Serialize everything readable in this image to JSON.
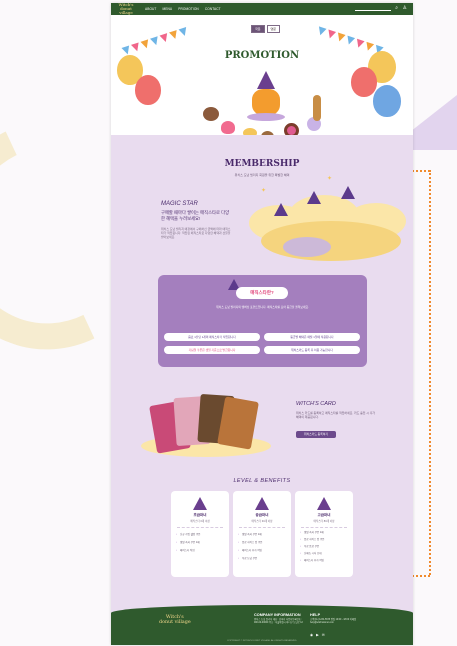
{
  "topbar": {
    "logo_line1": "Witch's",
    "logo_line2": "donut village",
    "nav": [
      "ABOUT",
      "MENU",
      "PROMOTION",
      "CONTACT"
    ]
  },
  "hero": {
    "lang_on": "국문",
    "lang_off": "영문",
    "title": "PROMOTION"
  },
  "membership": {
    "title": "MEMBERSHIP",
    "subtitle": "위치스 도넛 빌리지 회원을 위한 특별한 혜택",
    "magic_title": "MAGIC STAR",
    "magic_lead": "구매할 때마다 쌓이는 매직스타로 다양한 혜택을 누려보세요!",
    "magic_body": "위치스 도넛 빌리지 매장에서 구매하신 금액에 따라 매직스타가 적립됩니다. 적립된 매직스타로 다양한 혜택과 선물을 받아보세요."
  },
  "faq": {
    "title": "매직스타란?",
    "desc": "위치스 도넛 빌리지의 멤버십 포인트입니다. 매직스타를 모아 등급을 올려보세요.",
    "buttons": [
      "음료 1잔당 1개의 매직스타가 적립됩니다",
      "등급별 혜택은 매월 1일에 적용됩니다",
      "기념일 쿠폰은 생일 기준으로 발급됩니다",
      "위치스카드 등록 후 이용 가능합니다"
    ]
  },
  "witch_card": {
    "title": "WITCH'S CARD",
    "body": "위치스 카드를 등록하고 매직스타를 적립하세요. 카드 충전 시 추가 혜택이 제공됩니다.",
    "button": "위치스카드 등록하기"
  },
  "levels": {
    "title": "LEVEL & BENEFITS",
    "cards": [
      {
        "name": "초급마녀",
        "cond": "매직스타 0개 이상",
        "benefits": [
          "신규 가입 웰컴 쿠폰",
          "생일 축하 쿠폰 1매",
          "매직스타 적립"
        ]
      },
      {
        "name": "중급마녀",
        "cond": "매직스타 30개 이상",
        "benefits": [
          "생일 축하 쿠폰 1매",
          "음료 사이즈 업 쿠폰",
          "매직스타 추가 적립",
          "무료 도넛 쿠폰"
        ]
      },
      {
        "name": "고급마녀",
        "cond": "매직스타 80개 이상",
        "benefits": [
          "생일 축하 쿠폰 1매",
          "음료 사이즈 업 쿠폰",
          "무료 음료 쿠폰",
          "신메뉴 시식 초대",
          "매직스타 추가 적립"
        ]
      }
    ]
  },
  "footer": {
    "logo_line1": "Witch's",
    "logo_line2": "donut village",
    "company_title": "COMPANY INFORMATION",
    "company_text": "위치스 도넛 빌리지 대표 : 김마녀 사업자등록번호 : 000-00-00000 주소 : 서울특별시 마녀구 도넛로 12",
    "help_title": "HELP",
    "help_text": "고객센터 1234-5678 평일 10:00 - 18:00 이메일 help@witchsdonut.com",
    "social": [
      "◉",
      "▶",
      "✉"
    ],
    "copyright": "COPYRIGHT © WITCH'S DONUT VILLAGE. ALL RIGHTS RESERVED."
  }
}
